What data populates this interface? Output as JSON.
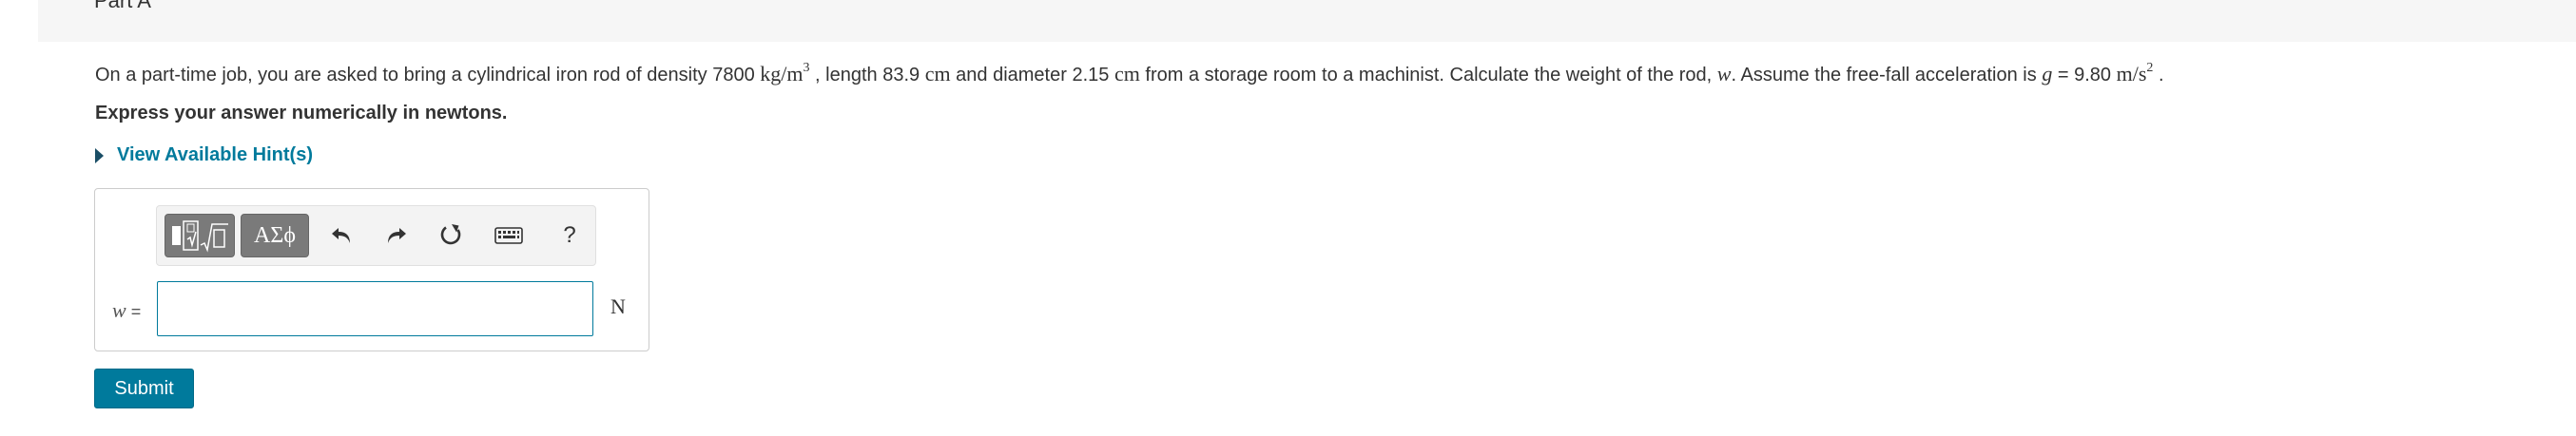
{
  "part": {
    "title": "Part A"
  },
  "question": {
    "t1": "On a part-time job, you are asked to bring a cylindrical iron rod of density 7800 ",
    "density_unit": "kg/m",
    "density_exp": "3",
    "t2": " , length 83.9 ",
    "length_unit": "cm",
    "t3": " and diameter 2.15 ",
    "diameter_unit": "cm",
    "t4": " from a storage room to a machinist. Calculate the weight of the rod, ",
    "weight_var": "w",
    "t5": ". Assume the free-fall acceleration is ",
    "g_var": "g",
    "t6": " = 9.80 ",
    "g_unit": "m/s",
    "g_exp": "2",
    "t7": " ."
  },
  "instruction": "Express your answer numerically in newtons.",
  "hint": {
    "label": "View Available Hint(s)"
  },
  "toolbar": {
    "templates_icon": "templates-icon",
    "symbols_label": "ΑΣϕ",
    "undo_icon": "undo-icon",
    "redo_icon": "redo-icon",
    "reset_icon": "reset-icon",
    "keyboard_icon": "keyboard-icon",
    "help_label": "?"
  },
  "answer": {
    "variable": "w",
    "equals": " =",
    "value": "",
    "unit": "N"
  },
  "submit": {
    "label": "Submit"
  },
  "colors": {
    "accent": "#007a9c",
    "text": "#333333",
    "toolbar_button": "#7a7a7a",
    "top_band": "#f6f6f6"
  }
}
